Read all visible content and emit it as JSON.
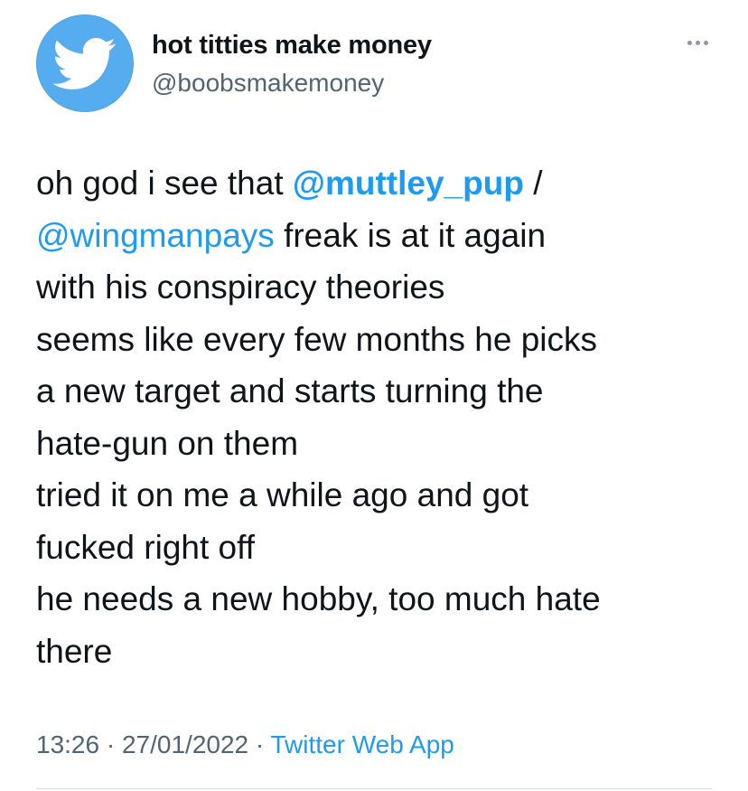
{
  "author": {
    "display_name": "hot titties make money",
    "handle": "@boobsmakemoney",
    "avatar_icon": "twitter-bird-icon",
    "avatar_color": "#55acee"
  },
  "more_options_icon": "ellipsis-icon",
  "tweet": {
    "lines": [
      {
        "pre": "oh god i see that ",
        "mention": "@muttley_pup",
        "post": " /"
      },
      {
        "mention": "@wingmanpays",
        "post": " freak is at it again"
      },
      {
        "text": "with his conspiracy theories"
      },
      {
        "text": "seems like every few months he picks"
      },
      {
        "text": "a new target and starts turning the"
      },
      {
        "text": "hate-gun on them"
      },
      {
        "text": "tried it on me a while ago and got"
      },
      {
        "text": "fucked right off"
      },
      {
        "text": "he needs a new hobby, too much hate"
      },
      {
        "text": "there"
      }
    ]
  },
  "meta": {
    "time": "13:26",
    "separator": " · ",
    "date": "27/01/2022",
    "source": "Twitter Web App"
  },
  "colors": {
    "link": "#1d9bf0",
    "secondary_text": "#536471",
    "primary_text": "#0f1419"
  }
}
